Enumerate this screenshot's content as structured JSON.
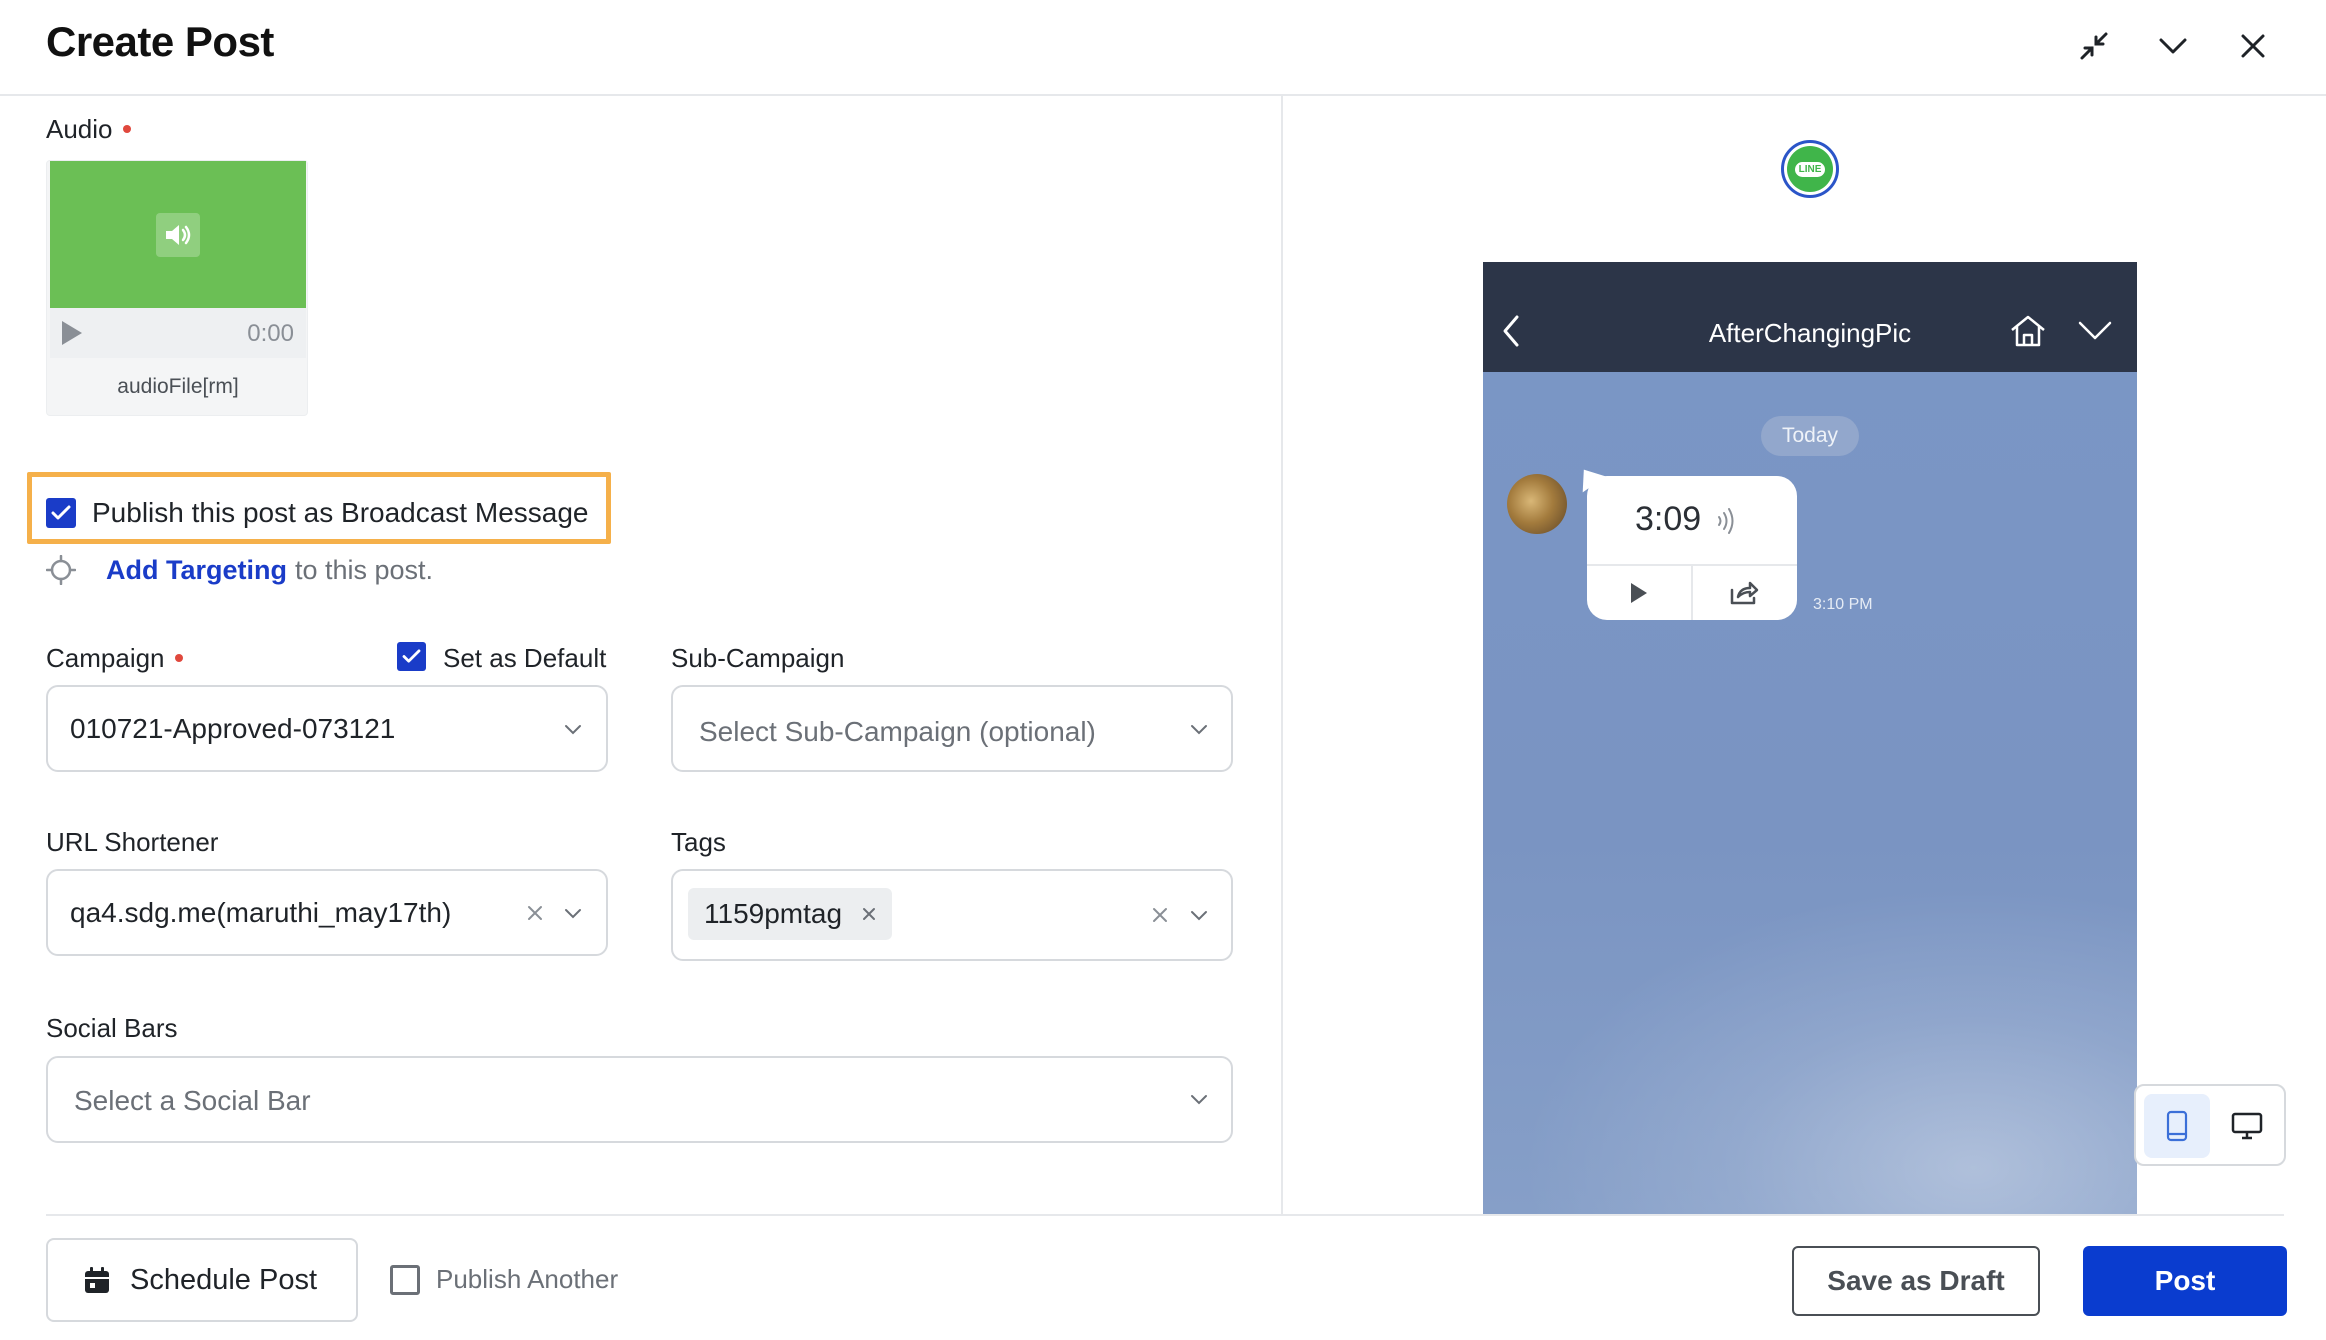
{
  "header": {
    "title": "Create Post",
    "icons": [
      "collapse-icon",
      "chevron-down-icon",
      "close-icon"
    ]
  },
  "audio": {
    "label": "Audio",
    "required": true,
    "time": "0:00",
    "filename": "audioFile[rm]",
    "cover_color": "#6bbf55"
  },
  "broadcast": {
    "label": "Publish this post as Broadcast Message",
    "checked": true
  },
  "targeting": {
    "link": "Add Targeting",
    "suffix": "to this post."
  },
  "campaign": {
    "label": "Campaign",
    "required": true,
    "default_label": "Set as Default",
    "default_checked": true,
    "value": "010721-Approved-073121"
  },
  "sub_campaign": {
    "label": "Sub-Campaign",
    "placeholder": "Select Sub-Campaign (optional)"
  },
  "url_shortener": {
    "label": "URL Shortener",
    "value": "qa4.sdg.me(maruthi_may17th)"
  },
  "tags": {
    "label": "Tags",
    "chips": [
      "1159pmtag"
    ]
  },
  "social_bars": {
    "label": "Social Bars",
    "placeholder": "Select a Social Bar"
  },
  "footer": {
    "schedule_label": "Schedule Post",
    "publish_another_label": "Publish Another",
    "publish_another_checked": false,
    "save_draft_label": "Save as Draft",
    "post_label": "Post"
  },
  "preview": {
    "network_icon": "line-icon",
    "network_badge_text": "LINE",
    "chat_title": "AfterChangingPic",
    "date_pill": "Today",
    "audio_duration": "3:09",
    "message_time": "3:10 PM",
    "view_modes": [
      "mobile",
      "desktop"
    ],
    "active_view": "mobile"
  },
  "colors": {
    "accent": "#1a3cc8",
    "post_button": "#0a3ccf",
    "highlight_border": "#f5b04a",
    "required_dot": "#e0483d",
    "line_green": "#40b54a",
    "phone_header": "#2c3548",
    "chat_background": "#7a96c6"
  }
}
